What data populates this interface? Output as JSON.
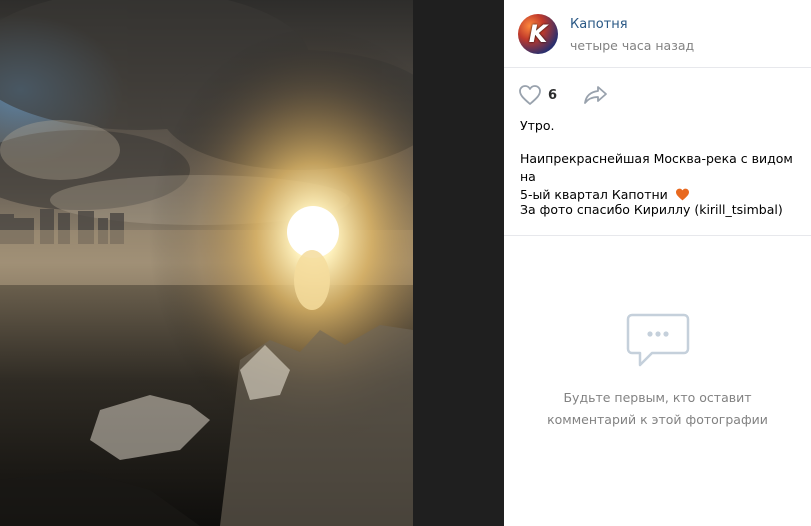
{
  "post": {
    "author": "Капотня",
    "time": "четыре часа назад",
    "avatar_letter": "K",
    "likes": "6",
    "text_line1": "Утро.",
    "text_line2a": "Наипрекраснейшая Москва-река с видом на",
    "text_line2b": "5-ый квартал Капотни",
    "text_line3": "За фото спасибо Кириллу (kirill_tsimbal)",
    "emoji": "orange-heart"
  },
  "comments": {
    "empty_line1": "Будьте первым, кто оставит",
    "empty_line2": "комментарий к этой фотографии"
  },
  "colors": {
    "link": "#2a5885",
    "muted": "#828282",
    "accent_heart": "#e8691f"
  },
  "icons": [
    "heart-outline-icon",
    "share-arrow-icon",
    "comments-bubble-icon"
  ]
}
